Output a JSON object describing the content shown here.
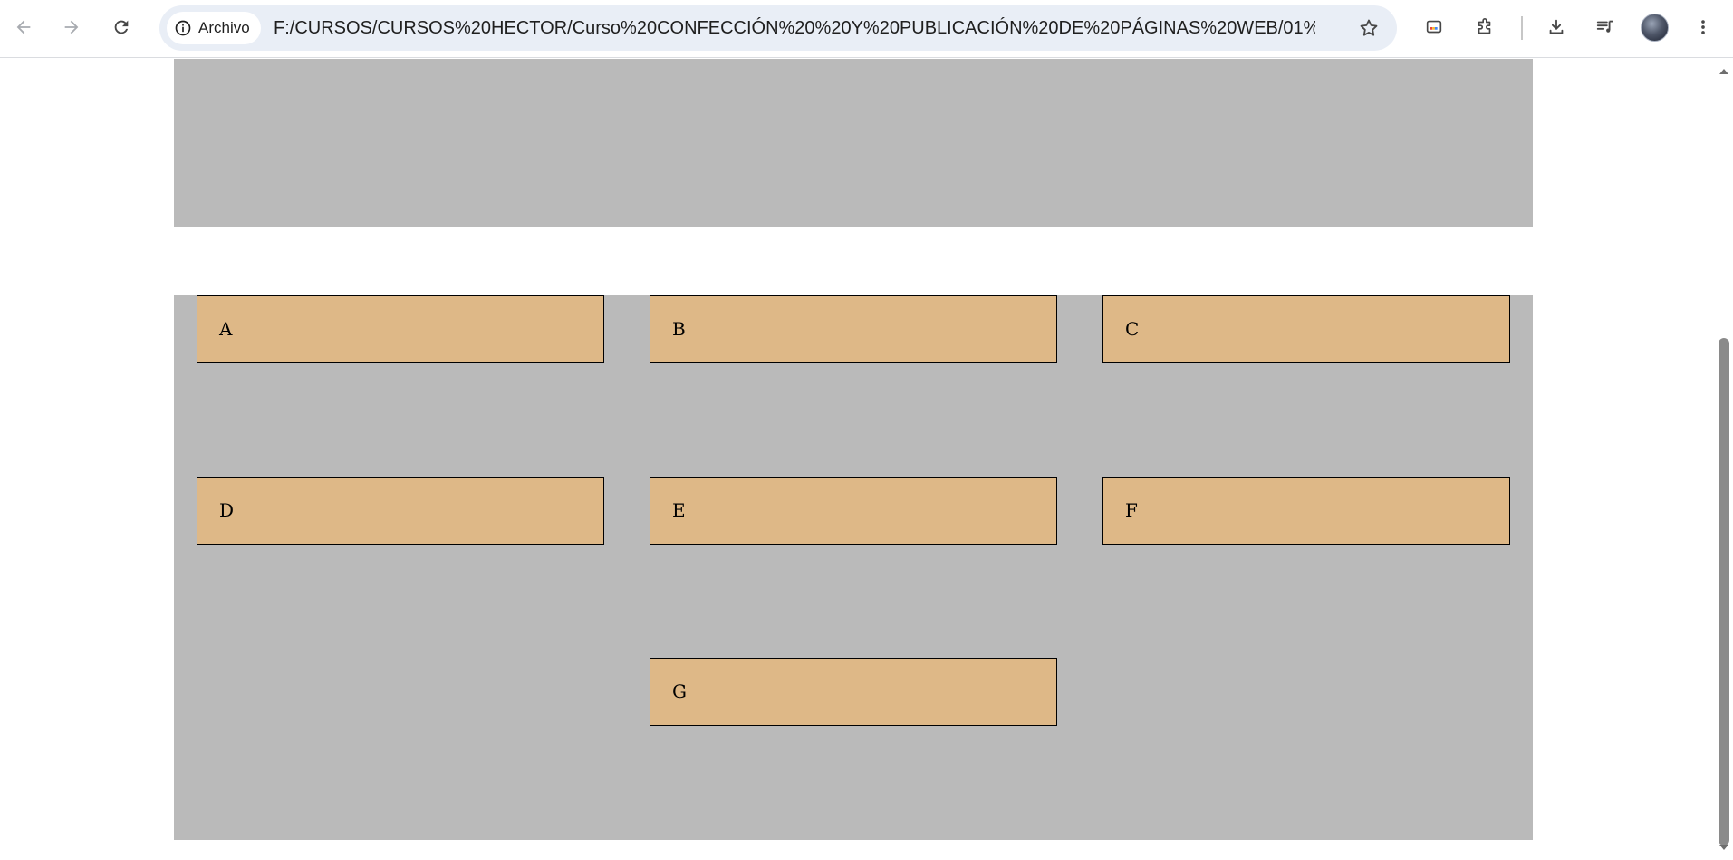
{
  "browser": {
    "site_chip_label": "Archivo",
    "url": "F:/CURSOS/CURSOS%20HECTOR/Curso%20CONFECCIÓN%20%20Y%20PUBLICACIÓN%20DE%20PÁGINAS%20WEB/01%20...",
    "icons": [
      "back-icon",
      "forward-icon",
      "reload-icon",
      "info-icon",
      "star-icon",
      "cast-icon",
      "extensions-icon",
      "download-icon",
      "media-control-icon",
      "avatar",
      "menu-icon"
    ]
  },
  "colors": {
    "band": "#bababa",
    "item_fill": "#deb887",
    "item_border": "#000000"
  },
  "grid": {
    "items": [
      {
        "label": "A"
      },
      {
        "label": "B"
      },
      {
        "label": "C"
      },
      {
        "label": "D"
      },
      {
        "label": "E"
      },
      {
        "label": "F"
      },
      {
        "label": "G"
      }
    ]
  }
}
